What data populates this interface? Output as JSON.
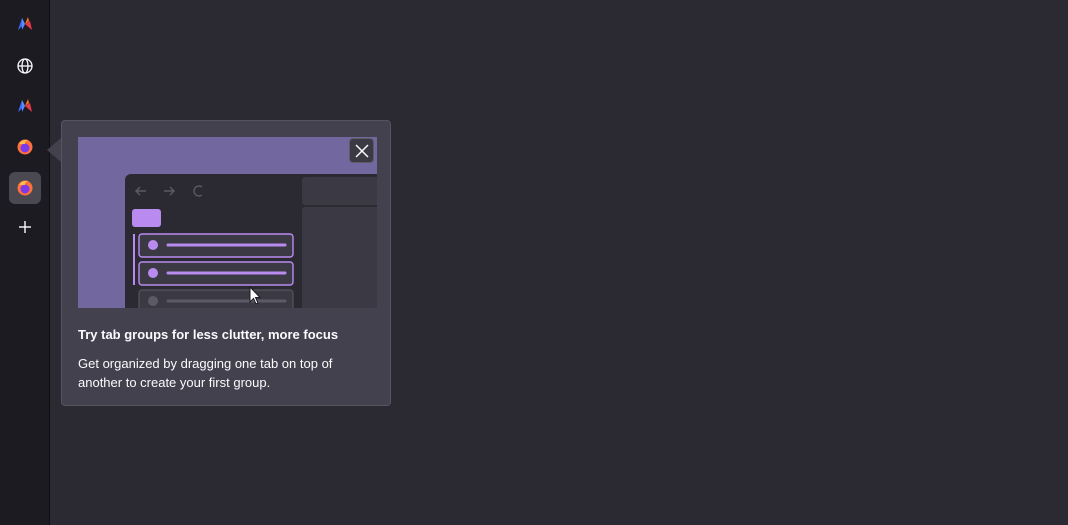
{
  "sidebar": {
    "items": [
      {
        "name": "app-logo-icon"
      },
      {
        "name": "globe-icon"
      },
      {
        "name": "app-logo-icon"
      },
      {
        "name": "firefox-icon"
      },
      {
        "name": "firefox-icon",
        "active": true
      },
      {
        "name": "plus-icon"
      }
    ]
  },
  "popup": {
    "title": "Try tab groups for less clutter, more focus",
    "body": "Get organized by dragging one tab on top of another to create your first group.",
    "close_icon": "close-icon"
  },
  "colors": {
    "background": "#2b2a33",
    "sidebar": "#1c1b22",
    "popup": "#42414d",
    "illustration_bg": "#7367a0",
    "accent": "#b98bf0"
  }
}
